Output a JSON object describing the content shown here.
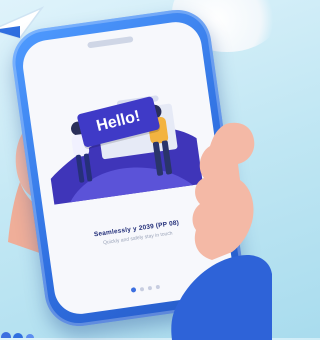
{
  "colors": {
    "background": "#bfe6f3",
    "phone_body": "#2f6fe0",
    "screen": "#f7f8fc",
    "sign": "#3f3ac7",
    "skin": "#f4b9a6",
    "sleeve": "#2e63d8"
  },
  "screen": {
    "sign_text": "Hello!",
    "caption_title": "Seamlessly y 2039 (PP 08)",
    "caption_sub": "Quickly and safely stay in touch"
  },
  "pager": {
    "count": 4,
    "active_index": 0
  }
}
